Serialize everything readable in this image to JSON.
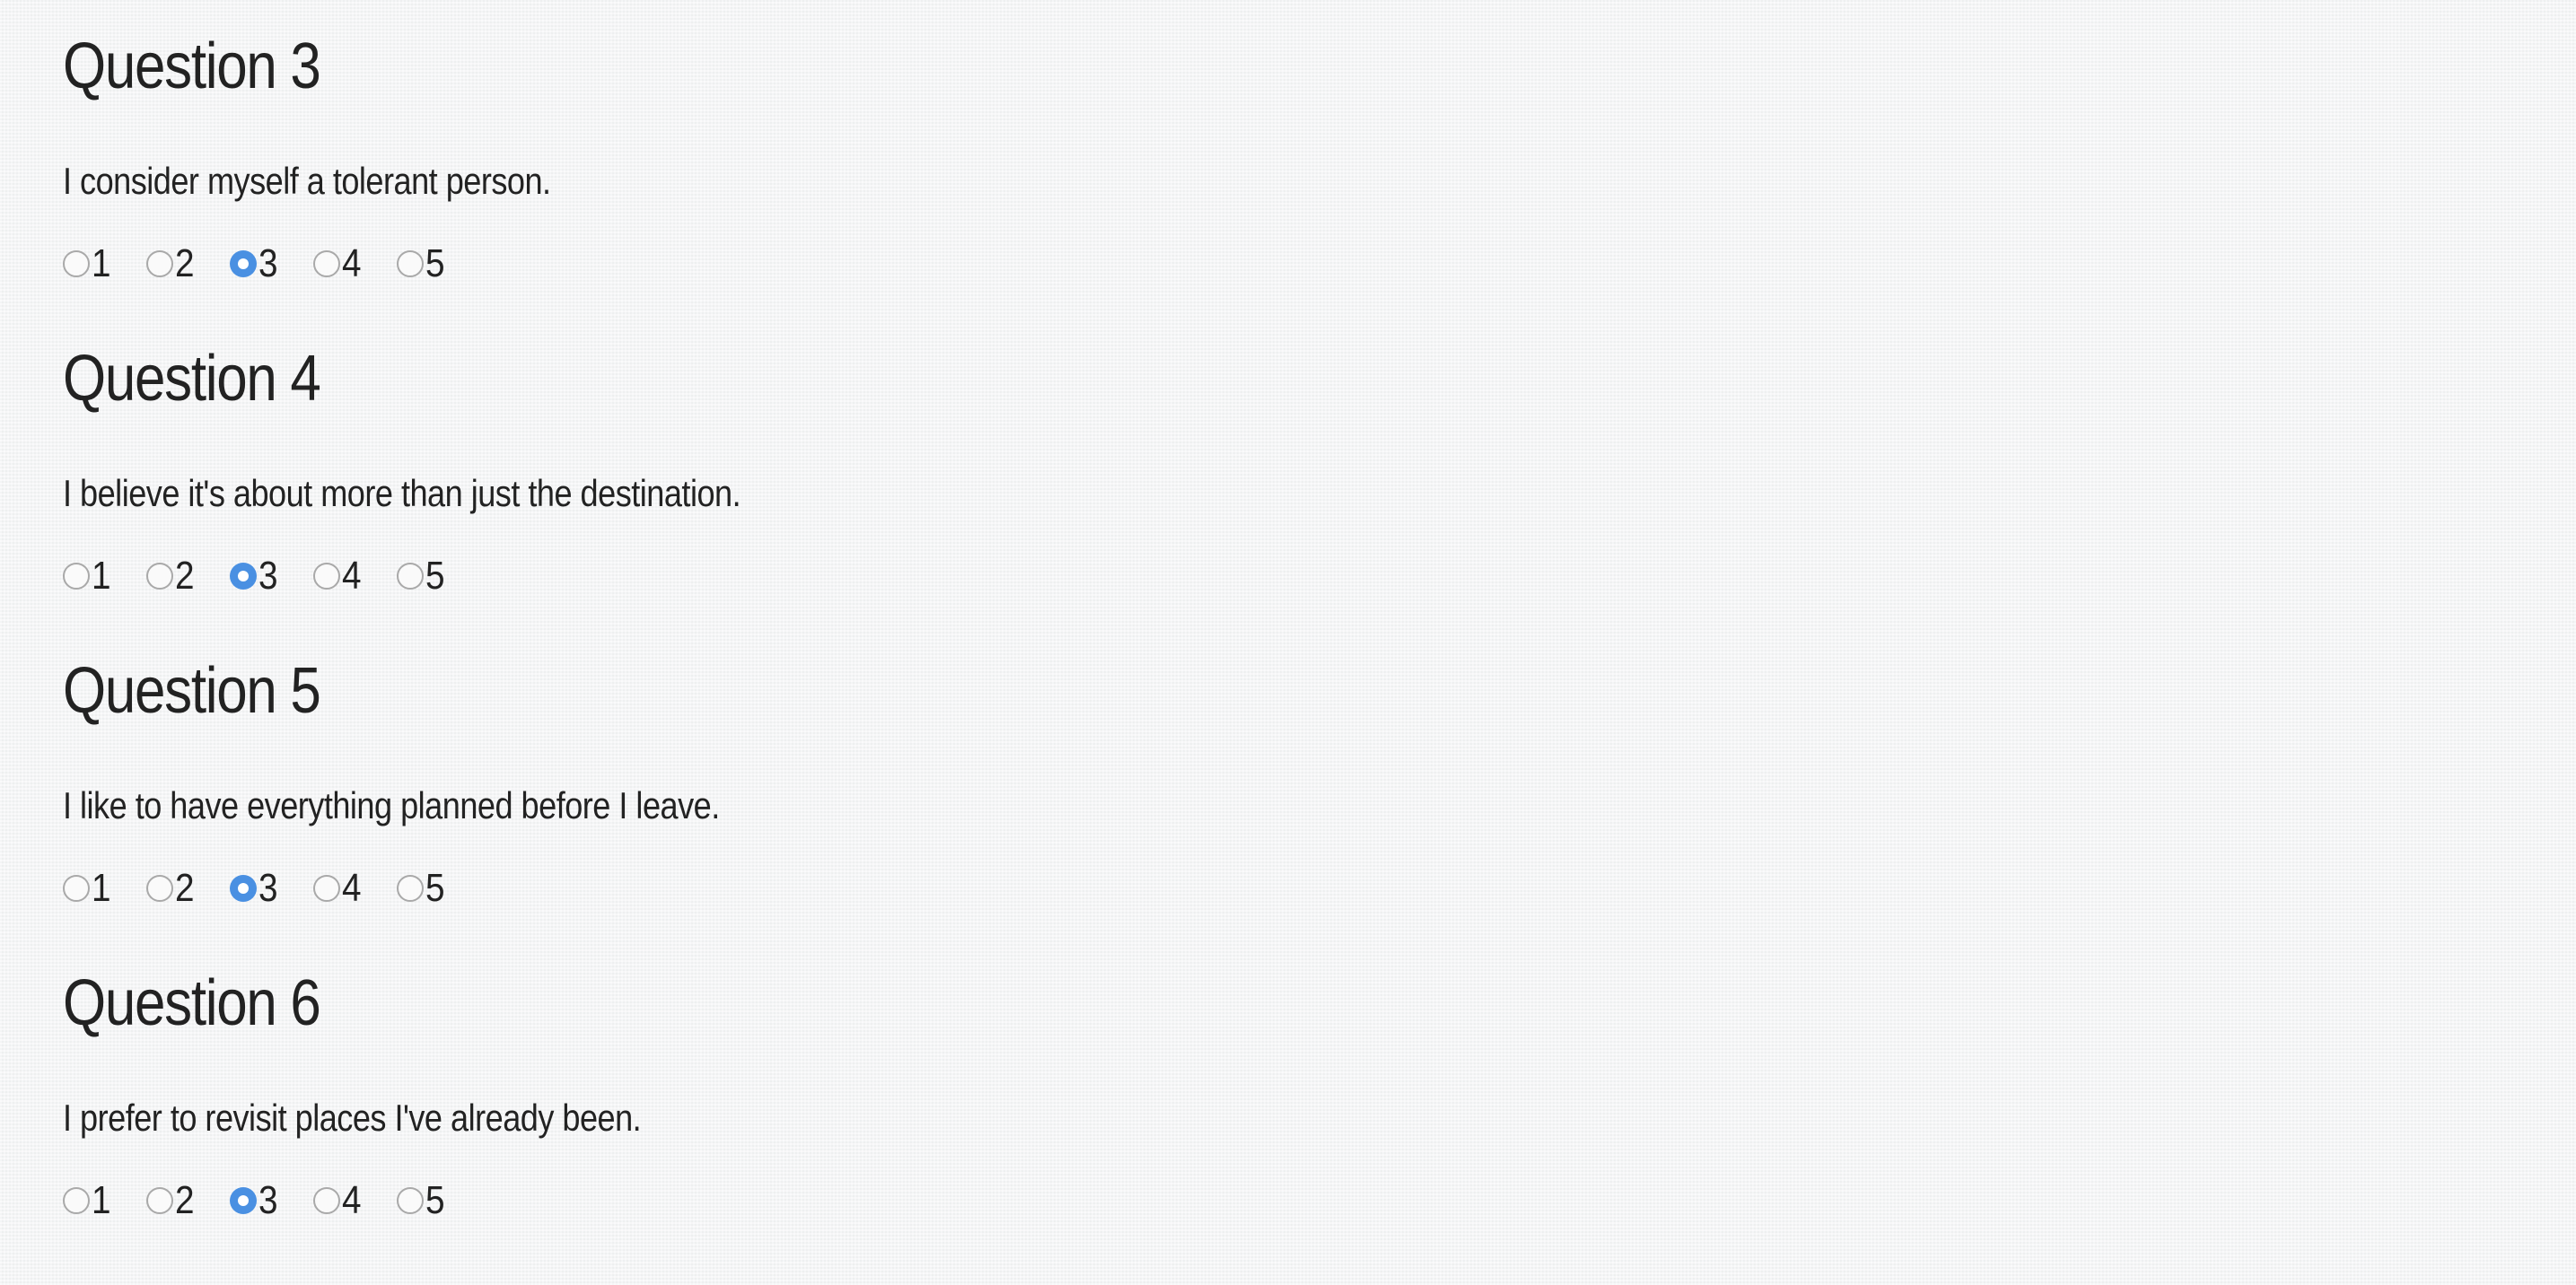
{
  "questions": [
    {
      "title": "Question 3",
      "text": "I consider myself a tolerant person.",
      "options": [
        "1",
        "2",
        "3",
        "4",
        "5"
      ],
      "selected": "3"
    },
    {
      "title": "Question 4",
      "text": "I believe it's about more than just the destination.",
      "options": [
        "1",
        "2",
        "3",
        "4",
        "5"
      ],
      "selected": "3"
    },
    {
      "title": "Question 5",
      "text": "I like to have everything planned before I leave.",
      "options": [
        "1",
        "2",
        "3",
        "4",
        "5"
      ],
      "selected": "3"
    },
    {
      "title": "Question 6",
      "text": "I prefer to revisit places I've already been.",
      "options": [
        "1",
        "2",
        "3",
        "4",
        "5"
      ],
      "selected": "3"
    }
  ],
  "colors": {
    "accent": "#4a90e2",
    "text": "#222222",
    "background": "#f4f5f6"
  }
}
